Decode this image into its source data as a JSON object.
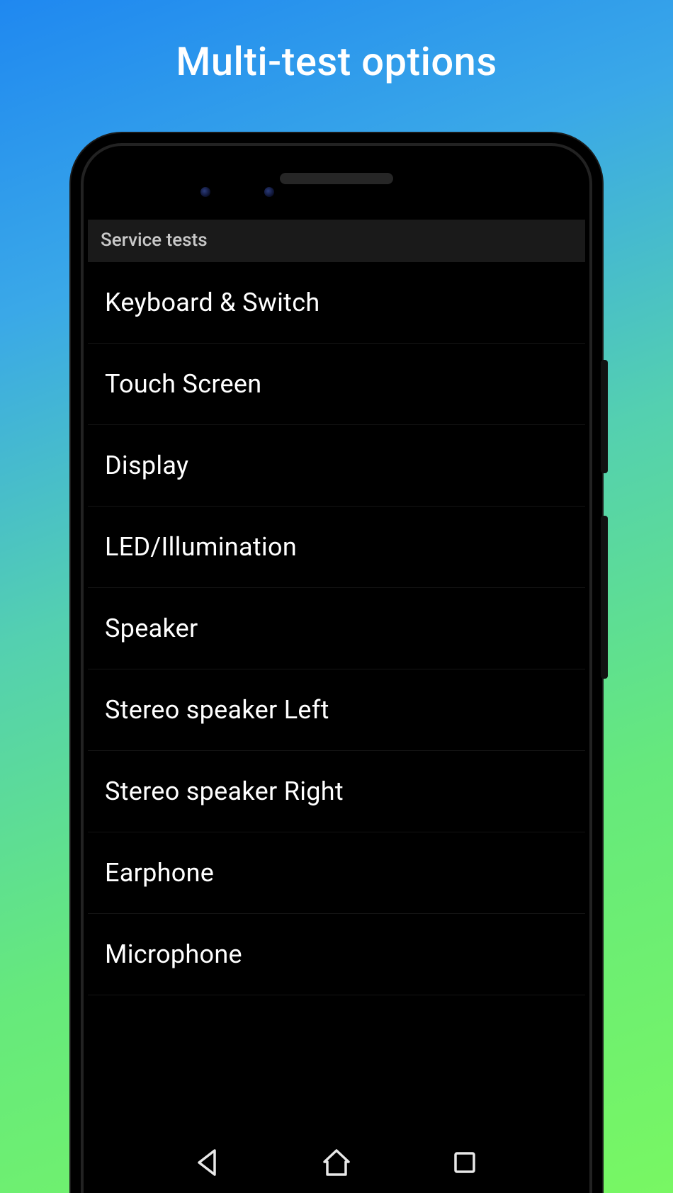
{
  "page_title": "Multi-test options",
  "app_header": "Service tests",
  "list_items": [
    {
      "label": "Keyboard & Switch"
    },
    {
      "label": "Touch Screen"
    },
    {
      "label": "Display"
    },
    {
      "label": "LED/Illumination"
    },
    {
      "label": "Speaker"
    },
    {
      "label": "Stereo speaker Left"
    },
    {
      "label": "Stereo speaker Right"
    },
    {
      "label": "Earphone"
    },
    {
      "label": "Microphone"
    }
  ]
}
